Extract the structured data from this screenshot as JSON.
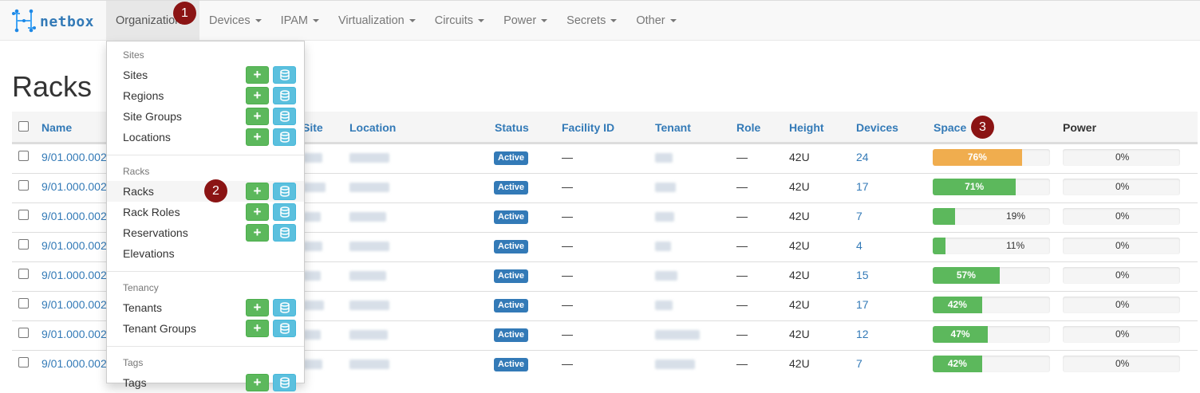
{
  "brand": {
    "name": "netbox",
    "logo_icon": "netbox-logo-icon"
  },
  "nav": {
    "items": [
      {
        "label": "Organization",
        "has_caret": false
      },
      {
        "label": "Devices"
      },
      {
        "label": "IPAM"
      },
      {
        "label": "Virtualization"
      },
      {
        "label": "Circuits"
      },
      {
        "label": "Power"
      },
      {
        "label": "Secrets"
      },
      {
        "label": "Other"
      }
    ]
  },
  "dropdown": {
    "sections": [
      {
        "header": "Sites",
        "items": [
          "Sites",
          "Regions",
          "Site Groups",
          "Locations"
        ]
      },
      {
        "header": "Racks",
        "items": [
          "Racks",
          "Rack Roles",
          "Reservations",
          "Elevations"
        ]
      },
      {
        "header": "Tenancy",
        "items": [
          "Tenants",
          "Tenant Groups"
        ]
      },
      {
        "header": "Tags",
        "items": [
          "Tags"
        ]
      }
    ],
    "add_icon": "plus-icon",
    "import_icon": "database-import-icon"
  },
  "page": {
    "title": "Racks"
  },
  "table": {
    "headers": {
      "name": "Name",
      "site": "Site",
      "location": "Location",
      "status": "Status",
      "facility_id": "Facility ID",
      "tenant": "Tenant",
      "role": "Role",
      "height": "Height",
      "devices": "Devices",
      "space": "Space",
      "power": "Power"
    },
    "rows": [
      {
        "name": "9/01.000.002",
        "status": "Active",
        "facility": "—",
        "role": "—",
        "height": "42U",
        "devices": "24",
        "space": "76%",
        "space_value": 76,
        "power": "0%"
      },
      {
        "name": "9/01.000.002",
        "status": "Active",
        "facility": "—",
        "role": "—",
        "height": "42U",
        "devices": "17",
        "space": "71%",
        "space_value": 71,
        "power": "0%"
      },
      {
        "name": "9/01.000.002",
        "status": "Active",
        "facility": "—",
        "role": "—",
        "height": "42U",
        "devices": "7",
        "space": "19%",
        "space_value": 19,
        "power": "0%"
      },
      {
        "name": "9/01.000.002",
        "status": "Active",
        "facility": "—",
        "role": "—",
        "height": "42U",
        "devices": "4",
        "space": "11%",
        "space_value": 11,
        "power": "0%"
      },
      {
        "name": "9/01.000.002",
        "status": "Active",
        "facility": "—",
        "role": "—",
        "height": "42U",
        "devices": "15",
        "space": "57%",
        "space_value": 57,
        "power": "0%"
      },
      {
        "name": "9/01.000.002",
        "status": "Active",
        "facility": "—",
        "role": "—",
        "height": "42U",
        "devices": "17",
        "space": "42%",
        "space_value": 42,
        "power": "0%"
      },
      {
        "name": "9/01.000.002",
        "status": "Active",
        "facility": "—",
        "role": "—",
        "height": "42U",
        "devices": "12",
        "space": "47%",
        "space_value": 47,
        "power": "0%"
      },
      {
        "name": "9/01.000.002",
        "status": "Active",
        "facility": "—",
        "role": "—",
        "height": "42U",
        "devices": "7",
        "space": "42%",
        "space_value": 42,
        "power": "0%"
      }
    ]
  },
  "markers": [
    "1",
    "2",
    "3"
  ],
  "colors": {
    "link": "#337ab7",
    "success": "#5cb85c",
    "warning": "#f0ad4e",
    "info": "#5bc0de",
    "marker": "#8b1414",
    "badge": "#337ab7"
  }
}
